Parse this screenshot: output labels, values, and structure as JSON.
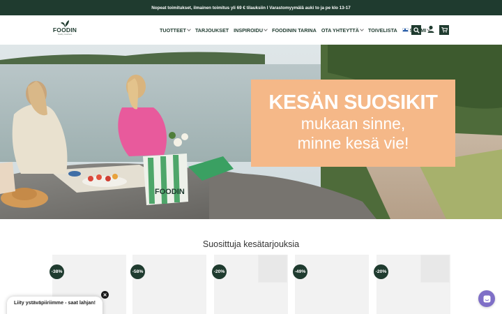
{
  "announcement": "Nopeat toimitukset, ilmainen toimitus yli 69 € tilauksiin I Varastomyymälä auki to ja pe klo 13-17",
  "logo": {
    "name": "FOODIN",
    "tagline": "Healthy Goodness"
  },
  "nav": {
    "items": [
      {
        "label": "TUOTTEET",
        "has_dropdown": true
      },
      {
        "label": "TARJOUKSET",
        "has_dropdown": false
      },
      {
        "label": "INSPIROIDU",
        "has_dropdown": true
      },
      {
        "label": "FOODININ TARINA",
        "has_dropdown": false
      },
      {
        "label": "OTA YHTEYTTÄ",
        "has_dropdown": true
      },
      {
        "label": "TOIVELISTA",
        "has_dropdown": false
      }
    ],
    "language": "SUOMI",
    "icons": [
      "search-icon",
      "user-icon",
      "cart-icon"
    ]
  },
  "hero": {
    "title": "KESÄN SUOSIKIT",
    "line1": "mukaan sinne,",
    "line2": "minne kesä vie!",
    "bag_text": "FOODIN",
    "promo_color": "#f5b888"
  },
  "section": {
    "title": "Suosittuja kesätarjouksia"
  },
  "products": [
    {
      "discount": "-38%"
    },
    {
      "discount": "-58%"
    },
    {
      "discount": "-20%"
    },
    {
      "discount": "-49%"
    },
    {
      "discount": "-20%"
    }
  ],
  "popup": {
    "text": "Liity ystäväpiiriimme - saat lahjan!"
  },
  "colors": {
    "brand": "#1f3b2f",
    "accent": "#f5b888",
    "chat": "#7f6fc7"
  }
}
